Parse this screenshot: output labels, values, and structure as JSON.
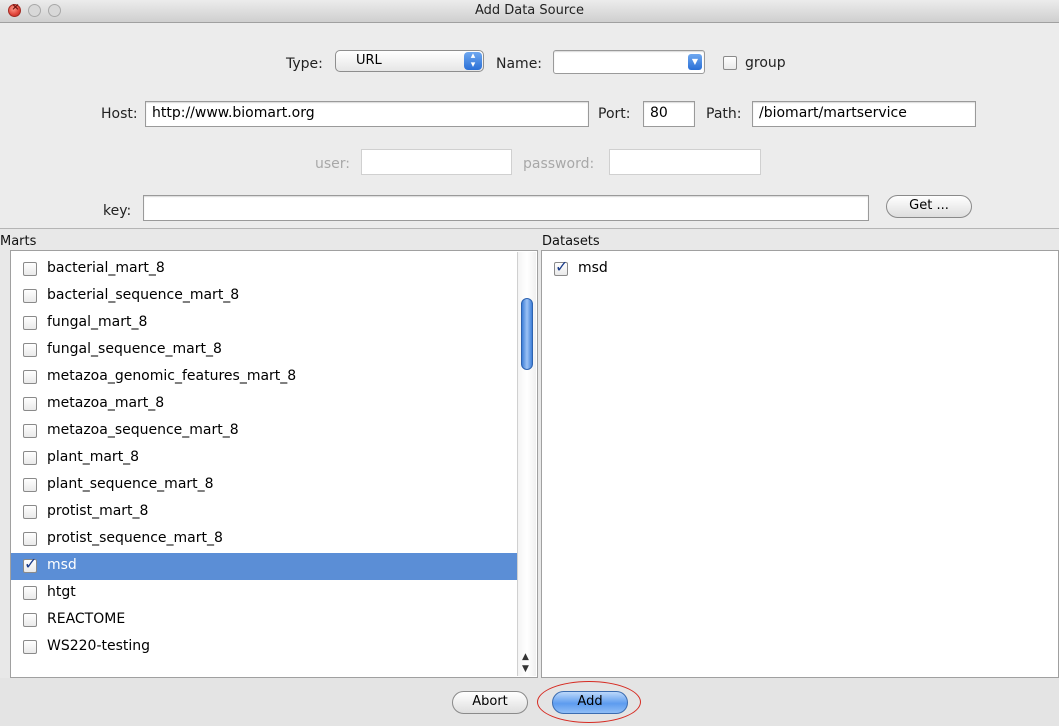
{
  "window": {
    "title": "Add Data Source"
  },
  "form": {
    "type_label": "Type:",
    "type_value": "URL",
    "name_label": "Name:",
    "name_value": "",
    "group_label": "group",
    "host_label": "Host:",
    "host_value": "http://www.biomart.org",
    "port_label": "Port:",
    "port_value": "80",
    "path_label": "Path:",
    "path_value": "/biomart/martservice",
    "user_label": "user:",
    "user_value": "",
    "password_label": "password:",
    "password_value": "",
    "key_label": "key:",
    "key_value": "",
    "get_button": "Get ..."
  },
  "marts": {
    "label": "Marts",
    "items": [
      {
        "name": "bacterial_mart_8",
        "checked": false,
        "selected": false
      },
      {
        "name": "bacterial_sequence_mart_8",
        "checked": false,
        "selected": false
      },
      {
        "name": "fungal_mart_8",
        "checked": false,
        "selected": false
      },
      {
        "name": "fungal_sequence_mart_8",
        "checked": false,
        "selected": false
      },
      {
        "name": "metazoa_genomic_features_mart_8",
        "checked": false,
        "selected": false
      },
      {
        "name": "metazoa_mart_8",
        "checked": false,
        "selected": false
      },
      {
        "name": "metazoa_sequence_mart_8",
        "checked": false,
        "selected": false
      },
      {
        "name": "plant_mart_8",
        "checked": false,
        "selected": false
      },
      {
        "name": "plant_sequence_mart_8",
        "checked": false,
        "selected": false
      },
      {
        "name": "protist_mart_8",
        "checked": false,
        "selected": false
      },
      {
        "name": "protist_sequence_mart_8",
        "checked": false,
        "selected": false
      },
      {
        "name": "msd",
        "checked": true,
        "selected": true
      },
      {
        "name": "htgt",
        "checked": false,
        "selected": false
      },
      {
        "name": "REACTOME",
        "checked": false,
        "selected": false
      },
      {
        "name": "WS220-testing",
        "checked": false,
        "selected": false
      }
    ]
  },
  "datasets": {
    "label": "Datasets",
    "items": [
      {
        "name": "msd",
        "checked": true
      }
    ]
  },
  "footer": {
    "abort_button": "Abort",
    "add_button": "Add"
  },
  "colors": {
    "selection": "#5b8ed6",
    "highlight_ring": "#d62b22"
  }
}
